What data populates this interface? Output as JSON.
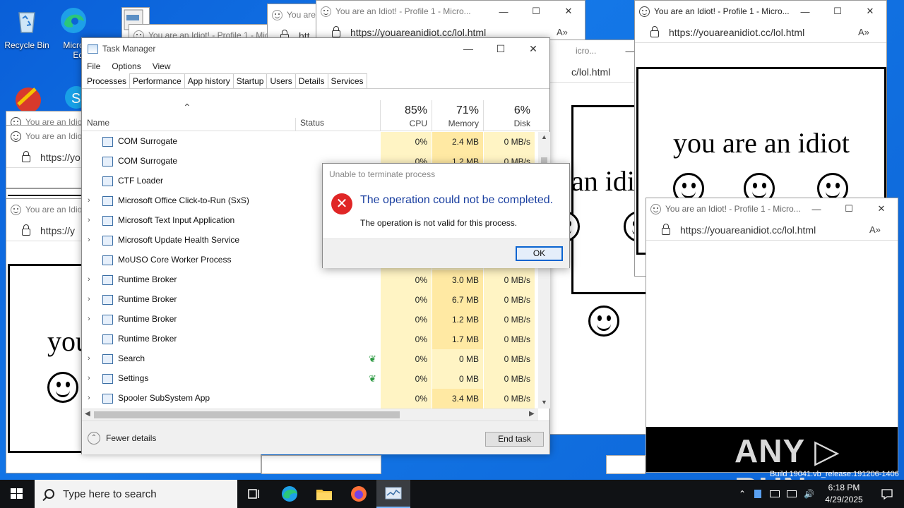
{
  "desktop": {
    "icons": [
      {
        "label": "Recycle Bin"
      },
      {
        "label": "Micro"
      },
      {
        "label": "Edg"
      }
    ]
  },
  "browser": {
    "title": "You are an Idiot! - Profile 1 - Micro...",
    "title_short": "You are an Idiot",
    "title_mid": "You are an Idiot! - Profile 1 - Micr",
    "title_tiny": "You are a",
    "url": "https://youareanidiot.cc/lol.html",
    "url_short": "https://yo",
    "url_partial": "c/lol.html",
    "url_htt": "htt",
    "url_frag": "https://y",
    "url_mid": "icro...",
    "page_text": "you are an idiot",
    "page_frag_1": "an idi",
    "page_frag_2": "you",
    "read_aloud": "Á»",
    "minimize": "—",
    "maximize": "☐",
    "close": "✕"
  },
  "task_manager": {
    "title": "Task Manager",
    "minimize": "—",
    "maximize": "☐",
    "close": "✕",
    "menu": [
      "File",
      "Options",
      "View"
    ],
    "tabs": [
      "Processes",
      "Performance",
      "App history",
      "Startup",
      "Users",
      "Details",
      "Services"
    ],
    "active_tab": "Processes",
    "sort_indicator": "^",
    "columns": {
      "name": "Name",
      "status": "Status",
      "cpu": {
        "pct": "85%",
        "label": "CPU"
      },
      "memory": {
        "pct": "71%",
        "label": "Memory"
      },
      "disk": {
        "pct": "6%",
        "label": "Disk"
      }
    },
    "processes": [
      {
        "name": "COM Surrogate",
        "expandable": false,
        "cpu": "0%",
        "mem": "2.4 MB",
        "disk": "0 MB/s",
        "leaf": false
      },
      {
        "name": "COM Surrogate",
        "expandable": false,
        "cpu": "0%",
        "mem": "1.2 MB",
        "disk": "0 MB/s",
        "leaf": false
      },
      {
        "name": "CTF Loader",
        "expandable": false,
        "cpu": "",
        "mem": "",
        "disk": "",
        "leaf": false
      },
      {
        "name": "Microsoft Office Click-to-Run (SxS)",
        "expandable": true,
        "cpu": "",
        "mem": "",
        "disk": "",
        "leaf": false
      },
      {
        "name": "Microsoft Text Input Application",
        "expandable": true,
        "cpu": "",
        "mem": "",
        "disk": "",
        "leaf": false
      },
      {
        "name": "Microsoft Update Health Service",
        "expandable": true,
        "cpu": "",
        "mem": "",
        "disk": "",
        "leaf": false
      },
      {
        "name": "MoUSO Core Worker Process",
        "expandable": false,
        "cpu": "",
        "mem": "",
        "disk": "",
        "leaf": false
      },
      {
        "name": "Runtime Broker",
        "expandable": true,
        "cpu": "0%",
        "mem": "3.0 MB",
        "disk": "0 MB/s",
        "leaf": false
      },
      {
        "name": "Runtime Broker",
        "expandable": true,
        "cpu": "0%",
        "mem": "6.7 MB",
        "disk": "0 MB/s",
        "leaf": false
      },
      {
        "name": "Runtime Broker",
        "expandable": true,
        "cpu": "0%",
        "mem": "1.2 MB",
        "disk": "0 MB/s",
        "leaf": false
      },
      {
        "name": "Runtime Broker",
        "expandable": false,
        "cpu": "0%",
        "mem": "1.7 MB",
        "disk": "0 MB/s",
        "leaf": false
      },
      {
        "name": "Search",
        "expandable": true,
        "cpu": "0%",
        "mem": "0 MB",
        "disk": "0 MB/s",
        "leaf": true
      },
      {
        "name": "Settings",
        "expandable": true,
        "cpu": "0%",
        "mem": "0 MB",
        "disk": "0 MB/s",
        "leaf": true
      },
      {
        "name": "Spooler SubSystem App",
        "expandable": true,
        "cpu": "0%",
        "mem": "3.4 MB",
        "disk": "0 MB/s",
        "leaf": false
      }
    ],
    "fewer_details": "Fewer details",
    "end_task": "End task"
  },
  "dialog": {
    "title": "Unable to terminate process",
    "main": "The operation could not be completed.",
    "sub": "The operation is not valid for this process.",
    "ok": "OK"
  },
  "taskbar": {
    "search_placeholder": "Type here to search",
    "time": "6:18 PM",
    "date": "4/29/2025"
  },
  "watermark": "ANY ▷ RUN",
  "build_text": "Build 19041.vb_release.191206-1406"
}
